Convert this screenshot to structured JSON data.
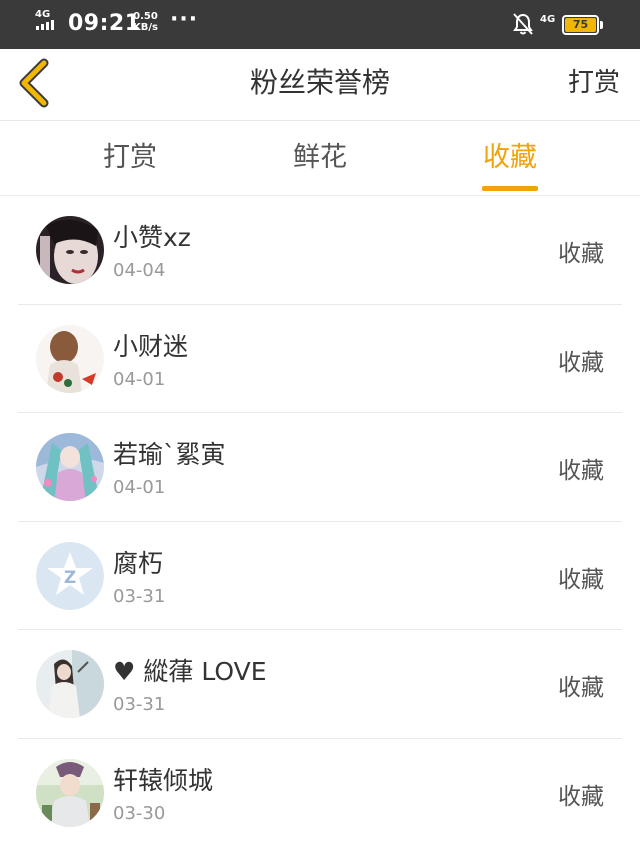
{
  "status_bar": {
    "network": "4G",
    "time": "09:21",
    "speed_value": "0.50",
    "speed_unit": "KB/s",
    "more": "···",
    "network_right": "4G",
    "battery": "75",
    "colors": {
      "background": "#3a3a3a",
      "battery": "#f2b705"
    }
  },
  "header": {
    "back_icon": "chevron-left-icon",
    "title": "粉丝荣誉榜",
    "action_label": "打赏"
  },
  "tabs": {
    "items": [
      {
        "label": "打赏",
        "active": false
      },
      {
        "label": "鲜花",
        "active": false
      },
      {
        "label": "收藏",
        "active": true
      }
    ],
    "accent_color": "#f0a30a"
  },
  "fans": [
    {
      "name": "小赞xz",
      "date": "04-04",
      "action": "收藏",
      "avatar": "avatar-dark-portrait"
    },
    {
      "name": "小财迷",
      "date": "04-01",
      "action": "收藏",
      "avatar": "avatar-girl-red-dress"
    },
    {
      "name": "若瑜`綤寅",
      "date": "04-01",
      "action": "收藏",
      "avatar": "avatar-anime-girl"
    },
    {
      "name": "腐朽",
      "date": "03-31",
      "action": "收藏",
      "avatar": "avatar-default-star"
    },
    {
      "name": "縱葎 LOVE",
      "date": "03-31",
      "action": "收藏",
      "avatar": "avatar-girl-light",
      "heart_icon": "heart-icon"
    },
    {
      "name": "轩辕倾城",
      "date": "03-30",
      "action": "收藏",
      "avatar": "avatar-child-outdoor"
    }
  ]
}
